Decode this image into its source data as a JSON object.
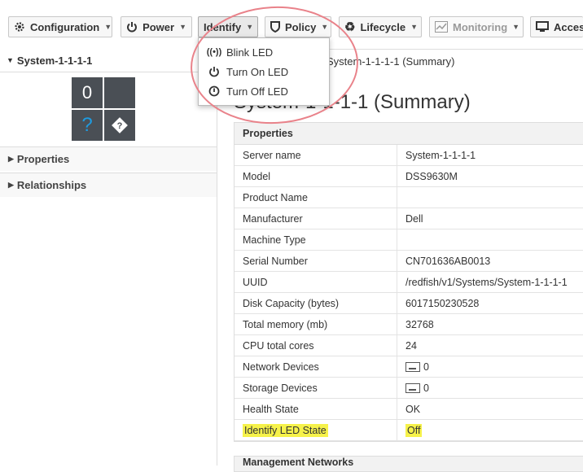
{
  "toolbar": {
    "configuration": "Configuration",
    "power": "Power",
    "identify": "Identify",
    "policy": "Policy",
    "lifecycle": "Lifecycle",
    "monitoring": "Monitoring",
    "access": "Access"
  },
  "identify_menu": {
    "items": [
      "Blink LED",
      "Turn On LED",
      "Turn Off LED"
    ]
  },
  "left_panel": {
    "system_name": "System-1-1-1-1",
    "tile_count": "0",
    "tile_unknown": "?",
    "sections": [
      "Properties",
      "Relationships"
    ]
  },
  "breadcrumb": "System-1-1-1-1 (Summary)",
  "page_title": "System-1-1-1-1 (Summary)",
  "properties": {
    "heading": "Properties",
    "rows": [
      {
        "key": "Server name",
        "value": "System-1-1-1-1"
      },
      {
        "key": "Model",
        "value": "DSS9630M"
      },
      {
        "key": "Product Name",
        "value": ""
      },
      {
        "key": "Manufacturer",
        "value": "Dell"
      },
      {
        "key": "Machine Type",
        "value": ""
      },
      {
        "key": "Serial Number",
        "value": "CN701636AB0013"
      },
      {
        "key": "UUID",
        "value": "/redfish/v1/Systems/System-1-1-1-1"
      },
      {
        "key": "Disk Capacity (bytes)",
        "value": "6017150230528"
      },
      {
        "key": "Total memory (mb)",
        "value": "32768"
      },
      {
        "key": "CPU total cores",
        "value": "24"
      },
      {
        "key": "Network Devices",
        "value": "0"
      },
      {
        "key": "Storage Devices",
        "value": "0"
      },
      {
        "key": "Health State",
        "value": "OK"
      },
      {
        "key": "Identify LED State",
        "value": "Off"
      }
    ]
  },
  "management_networks_heading": "Management Networks",
  "colors": {
    "highlight": "#f6f24a",
    "annotation_circle": "#e9828a",
    "tile": "#4a4f55",
    "tile_question": "#1e9be0"
  }
}
